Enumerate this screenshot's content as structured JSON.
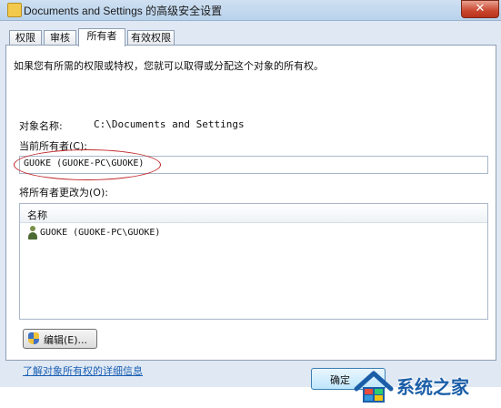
{
  "window": {
    "title": "Documents and Settings 的高级安全设置",
    "close_glyph": "✕"
  },
  "tabs": [
    {
      "label": "权限",
      "active": false
    },
    {
      "label": "审核",
      "active": false
    },
    {
      "label": "所有者",
      "active": true
    },
    {
      "label": "有效权限",
      "active": false
    }
  ],
  "owner_tab": {
    "intro": "如果您有所需的权限或特权，您就可以取得或分配这个对象的所有权。",
    "object_name_label": "对象名称:",
    "object_name_value": "C:\\Documents and Settings",
    "current_owner_label": "当前所有者(C):",
    "current_owner_value": "GUOKE (GUOKE-PC\\GUOKE)",
    "change_owner_label": "将所有者更改为(O):",
    "list_header": "名称",
    "owner_candidates": [
      "GUOKE (GUOKE-PC\\GUOKE)"
    ],
    "edit_button": "编辑(E)...",
    "learn_link": "了解对象所有权的详细信息"
  },
  "footer": {
    "ok_button": "确定"
  },
  "watermark": {
    "text": "系统之家"
  },
  "colors": {
    "highlight_ellipse": "#c0282a",
    "link": "#1a5fb4",
    "watermark": "#1b5ea8"
  }
}
